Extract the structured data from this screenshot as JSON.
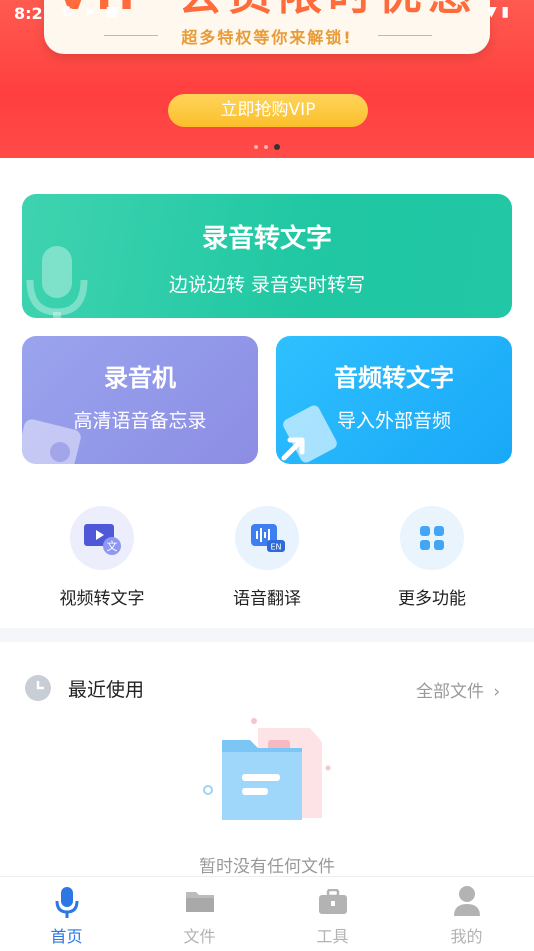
{
  "status_bar": {
    "time": "8:2"
  },
  "banner": {
    "title": "VIP 会员限时优惠",
    "subtitle": "超多特权等你来解锁!",
    "button_label": "立即抢购VIP",
    "page_count": 3,
    "active_page": 3
  },
  "cards": {
    "main": {
      "title": "录音转文字",
      "subtitle": "边说边转 录音实时转写"
    },
    "recorder": {
      "title": "录音机",
      "subtitle": "高清语音备忘录"
    },
    "audio": {
      "title": "音频转文字",
      "subtitle": "导入外部音频"
    }
  },
  "tools": [
    {
      "label": "视频转文字",
      "icon": "video-to-text-icon"
    },
    {
      "label": "语音翻译",
      "icon": "voice-translate-icon"
    },
    {
      "label": "更多功能",
      "icon": "more-grid-icon"
    }
  ],
  "recent": {
    "title": "最近使用",
    "more_label": "全部文件",
    "empty_text": "暂时没有任何文件"
  },
  "bottom_nav": [
    {
      "label": "首页",
      "icon": "mic-icon",
      "active": true
    },
    {
      "label": "文件",
      "icon": "folder-icon",
      "active": false
    },
    {
      "label": "工具",
      "icon": "toolbox-icon",
      "active": false
    },
    {
      "label": "我的",
      "icon": "user-icon",
      "active": false
    }
  ],
  "colors": {
    "banner_red": "#ff4a45",
    "vip_yellow": "#fbbf2c",
    "green_card": "#22c7a5",
    "purple_card": "#8c8de4",
    "blue_card": "#18a8f8",
    "nav_active": "#2b78e4"
  }
}
